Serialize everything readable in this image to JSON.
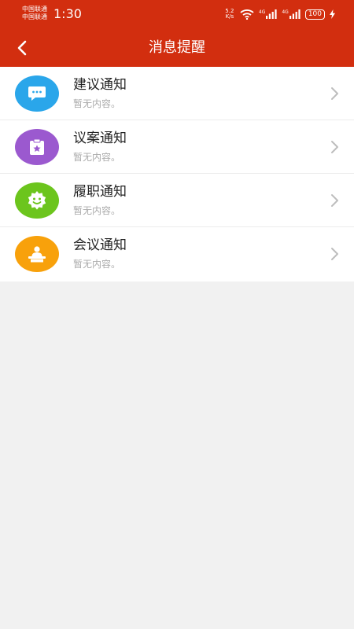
{
  "status_bar": {
    "carrier_1": "中国联通",
    "carrier_2": "中国联通",
    "time": "1:30",
    "speed_value": "5.2",
    "speed_unit": "K/s",
    "signal_1_tag": "4G",
    "signal_2_tag": "4G",
    "battery": "100"
  },
  "header": {
    "title": "消息提醒",
    "back_icon": "chevron-left-icon"
  },
  "notifications": [
    {
      "title": "建议通知",
      "subtitle": "暂无内容。",
      "icon": "chat-bubble-icon",
      "color": "#2aa6ea"
    },
    {
      "title": "议案通知",
      "subtitle": "暂无内容。",
      "icon": "clipboard-star-icon",
      "color": "#9b59cf"
    },
    {
      "title": "履职通知",
      "subtitle": "暂无内容。",
      "icon": "smiley-badge-icon",
      "color": "#6cc51d"
    },
    {
      "title": "会议通知",
      "subtitle": "暂无内容。",
      "icon": "person-podium-icon",
      "color": "#f8a10b"
    }
  ],
  "colors": {
    "primary": "#d22e0f",
    "background": "#f1f1f1"
  }
}
